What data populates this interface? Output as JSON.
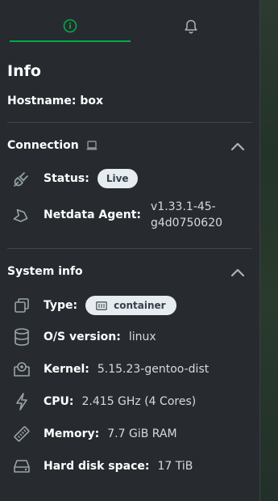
{
  "tabs": [
    {
      "icon": "info-icon"
    },
    {
      "icon": "bell-icon"
    }
  ],
  "heading": "Info",
  "hostname": "Hostname: box",
  "connection": {
    "title": "Connection",
    "status_label": "Status:",
    "status_value": "Live",
    "agent_label": "Netdata Agent:",
    "agent_value_line1": "v1.33.1-45-",
    "agent_value_line2": "g4d0750620"
  },
  "system": {
    "title": "System info",
    "type_label": "Type:",
    "type_value": "container",
    "os_label": "O/S version:",
    "os_value": "linux",
    "kernel_label": "Kernel:",
    "kernel_value": "5.15.23-gentoo-dist",
    "cpu_label": "CPU:",
    "cpu_value": "2.415 GHz (4 Cores)",
    "memory_label": "Memory:",
    "memory_value": "7.7 GiB RAM",
    "disk_label": "Hard disk space:",
    "disk_value": "17 TiB"
  },
  "colors": {
    "accent": "#00ab44",
    "panel": "#272b30"
  }
}
